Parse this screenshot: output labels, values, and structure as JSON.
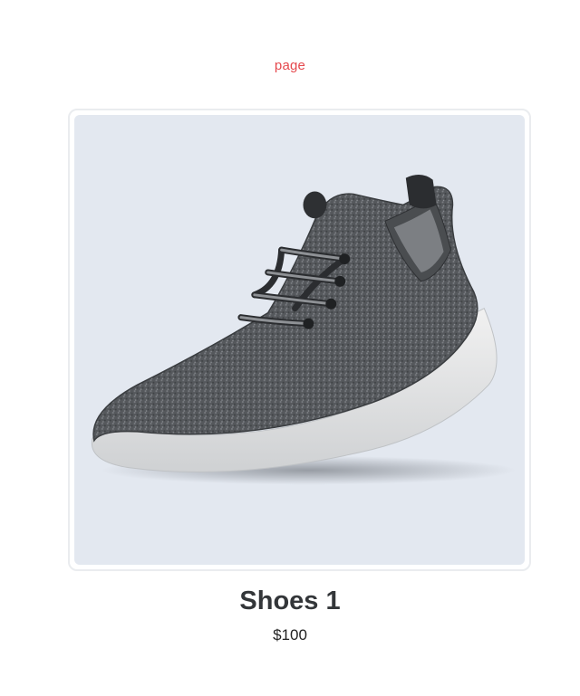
{
  "page": {
    "label": "page"
  },
  "product": {
    "name": "Shoes 1",
    "price": "$100",
    "image_icon": "sneaker-photo",
    "image_background": "#e3e8f0"
  },
  "colors": {
    "page_label": "#e5484d",
    "title_text": "#333639",
    "card_border": "#eaecef"
  }
}
